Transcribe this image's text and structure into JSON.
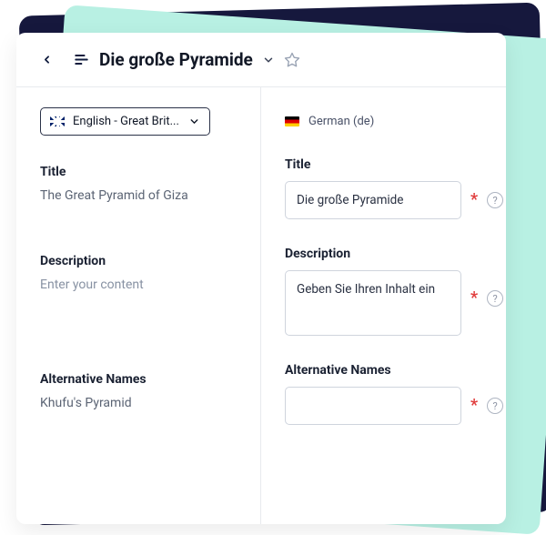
{
  "header": {
    "title": "Die große Pyramide"
  },
  "source_locale": {
    "selector_label": "English - Great Brit...",
    "fields": {
      "title": {
        "label": "Title",
        "value": "The Great Pyramid of Giza"
      },
      "description": {
        "label": "Description",
        "placeholder": "Enter your content"
      },
      "alt_names": {
        "label": "Alternative Names",
        "value": "Khufu's Pyramid"
      }
    }
  },
  "target_locale": {
    "label": "German (de)",
    "fields": {
      "title": {
        "label": "Title",
        "value": "Die große Pyramide"
      },
      "description": {
        "label": "Description",
        "value": "Geben Sie Ihren Inhalt ein"
      },
      "alt_names": {
        "label": "Alternative Names",
        "value": ""
      }
    }
  },
  "symbols": {
    "required": "*",
    "help": "?"
  }
}
